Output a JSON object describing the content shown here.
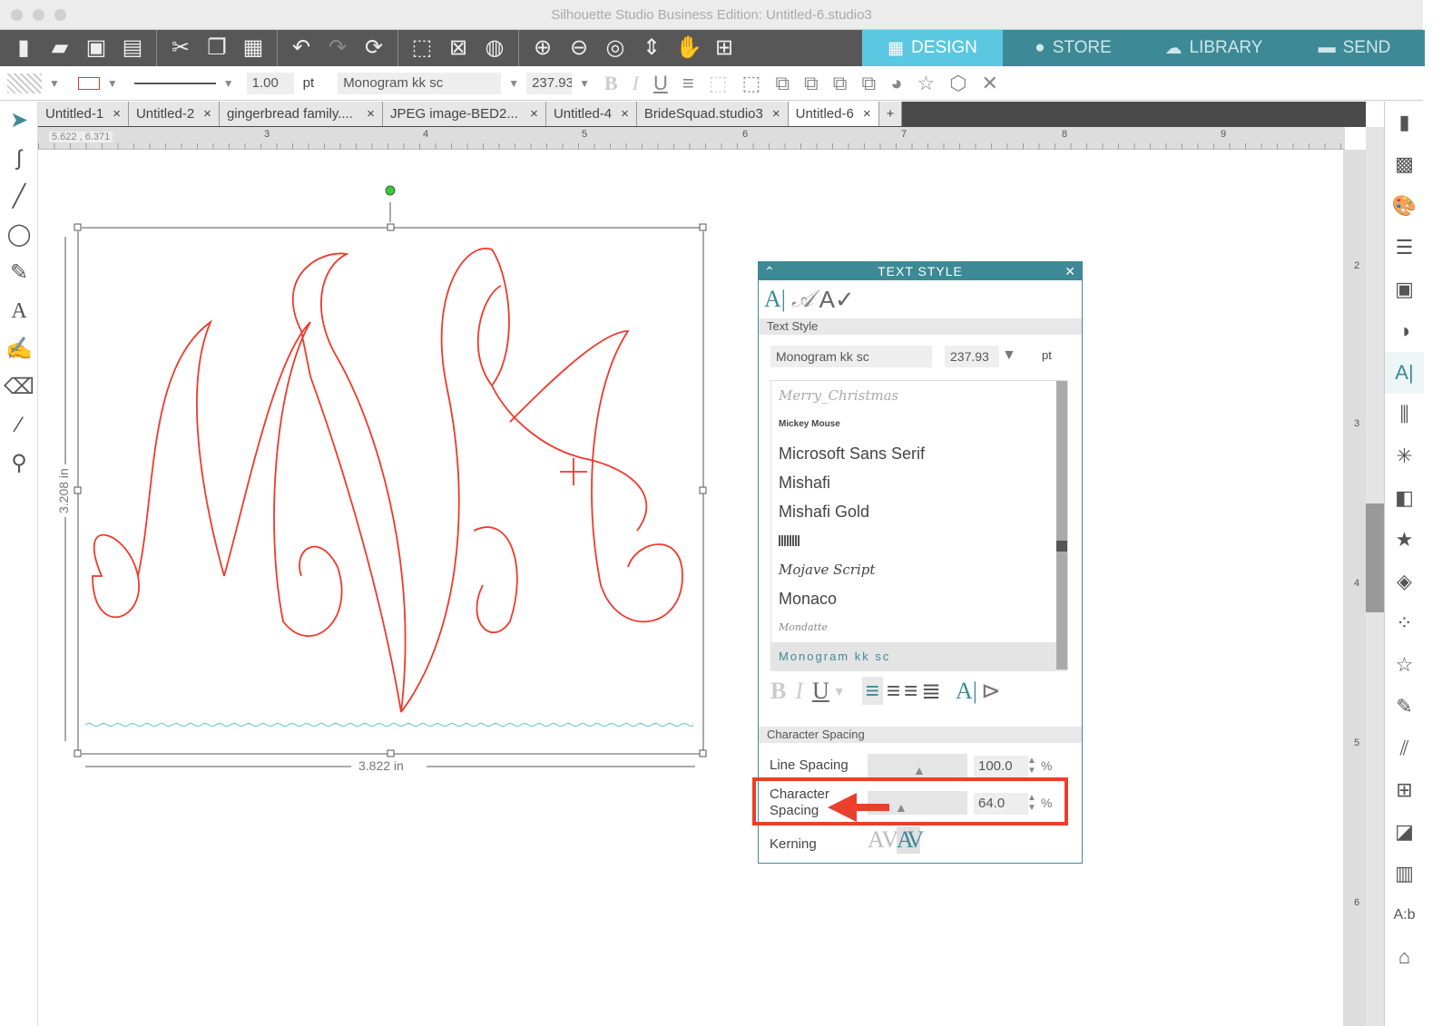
{
  "window": {
    "title": "Silhouette Studio Business Edition: Untitled-6.studio3"
  },
  "modes": [
    {
      "label": "DESIGN",
      "icon": "grid-icon",
      "active": true
    },
    {
      "label": "STORE",
      "icon": "silhouette-s-icon"
    },
    {
      "label": "LIBRARY",
      "icon": "cloud-download-icon"
    },
    {
      "label": "SEND",
      "icon": "cutter-icon"
    }
  ],
  "toolbar2": {
    "line_width": "1.00",
    "line_unit": "pt",
    "font": "Monogram kk sc",
    "font_size": "237.93"
  },
  "tabs": [
    {
      "label": "Untitled-1"
    },
    {
      "label": "Untitled-2"
    },
    {
      "label": "gingerbread family...."
    },
    {
      "label": "JPEG image-BED2..."
    },
    {
      "label": "Untitled-4"
    },
    {
      "label": "BrideSquad.studio3"
    },
    {
      "label": "Untitled-6",
      "active": true
    }
  ],
  "tab_add": "+",
  "ruler": {
    "coords": "5.622 , 6.371",
    "ticks": [
      "3",
      "4",
      "5",
      "6",
      "7",
      "8",
      "9"
    ],
    "vticks": [
      "2",
      "3",
      "4",
      "5",
      "6"
    ]
  },
  "canvas": {
    "height_label": "3.208 in",
    "width_label": "3.822 in",
    "stroke_color": "#f0392b"
  },
  "panel": {
    "title": "TEXT STYLE",
    "section_text_style": "Text Style",
    "font": "Monogram kk sc",
    "size": "237.93",
    "unit": "pt",
    "fonts": [
      "Merry_Christmas",
      "Mickey Mouse",
      "Microsoft Sans Serif",
      "Mishafi",
      "Mishafi Gold",
      "",
      "Mojave Script",
      "Monaco",
      "Mondatte",
      "Monogram kk sc"
    ],
    "section_char": "Character Spacing",
    "line_spacing_label": "Line Spacing",
    "line_spacing": "100.0",
    "char_spacing_label": "Character Spacing",
    "char_spacing": "64.0",
    "percent": "%",
    "kerning_label": "Kerning",
    "highlight_color": "#e8402a"
  }
}
